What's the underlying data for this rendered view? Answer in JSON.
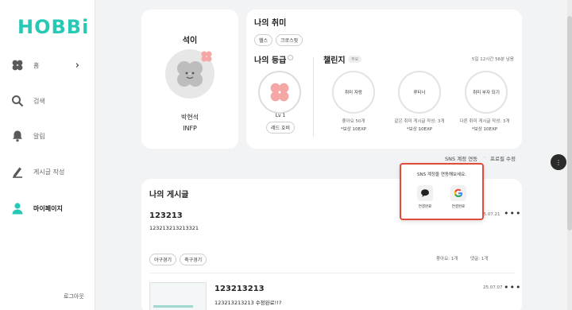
{
  "app": {
    "logo": "HOBBi"
  },
  "sidebar": {
    "items": [
      {
        "label": "홈",
        "icon": "clover-icon"
      },
      {
        "label": "검색",
        "icon": "search-icon"
      },
      {
        "label": "알림",
        "icon": "bell-icon"
      },
      {
        "label": "게시글 작성",
        "icon": "pencil-icon"
      },
      {
        "label": "마이페이지",
        "icon": "user-icon"
      }
    ],
    "logout": "로그아웃"
  },
  "profile": {
    "nickname": "석이",
    "name": "박현석",
    "mbti": "INFP"
  },
  "hobby": {
    "title": "나의 취미",
    "tags": [
      "헬스",
      "크로스핏"
    ]
  },
  "grade": {
    "title": "나의 등급",
    "level": "Lv 1",
    "badge": "레드 호비"
  },
  "challenge": {
    "title": "챌린지",
    "tag": "주요",
    "remaining": "5일 12시간 56분 남음",
    "items": [
      {
        "name": "취미 자랑",
        "desc": "좋아요 50개",
        "reward": "*보상 10EXP"
      },
      {
        "name": "루티너",
        "desc": "같은 취미 게시글 작성: 3개",
        "reward": "*보상 10EXP"
      },
      {
        "name": "취미 부자 되기",
        "desc": "다른 취미 게시글 작성: 3개",
        "reward": "*보상 10EXP"
      }
    ]
  },
  "links": {
    "sns": "SNS 계정 연동",
    "profile_edit": "프로필 수정"
  },
  "sns_popup": {
    "title": "SNS 계정을 연동해보세요.",
    "kakao_label": "연결완료",
    "google_label": "연결완료"
  },
  "posts": {
    "title": "나의 게시글",
    "items": [
      {
        "title": "123213",
        "body": "123213213213321",
        "date": "25.07.21",
        "tags": [
          "야구경기",
          "축구경기"
        ],
        "likes": "좋아요: 1개",
        "comments": "댓글: 1개"
      },
      {
        "title": "123213213",
        "body": "123213213213 수정완료!!?",
        "date": "25.07.07"
      }
    ]
  },
  "colors": {
    "brand": "#27c9b5",
    "accent_red": "#e24b3b",
    "clover_pink": "#f4a7a4",
    "clover_gray": "#bdbdbd"
  }
}
